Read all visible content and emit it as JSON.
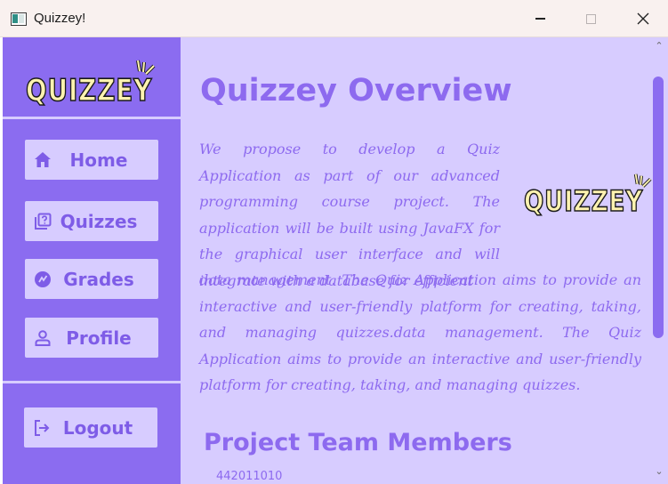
{
  "window": {
    "title": "Quizzey!",
    "icon": "app-window-icon",
    "controls": [
      "minimize",
      "maximize",
      "close"
    ]
  },
  "sidebar": {
    "logo_text": "QUIZZEY",
    "items": [
      {
        "label": "Home",
        "icon": "home-icon"
      },
      {
        "label": "Quizzes",
        "icon": "quiz-icon"
      },
      {
        "label": "Grades",
        "icon": "grades-icon"
      },
      {
        "label": "Profile",
        "icon": "person-icon"
      }
    ],
    "logout": {
      "label": "Logout",
      "icon": "logout-icon"
    }
  },
  "main": {
    "title": "Quizzey Overview",
    "paragraph_part1": "We propose to develop a Quiz Application as part of our advanced programming course project. The application will be built using JavaFX for the graphical user interface and will integrate with a database for efficient",
    "paragraph_part2": "data management. The Quiz Application aims to provide an interactive and user-friendly platform for creating, taking, and managing quizzes.data management. The Quiz Application aims to provide an interactive and user-friendly platform for creating, taking, and managing quizzes.",
    "logo_text": "QUIZZEY",
    "team_title": "Project Team Members",
    "team_first_row_peek": "442011010"
  },
  "colors": {
    "sidebar_bg": "#8b6cf0",
    "content_bg": "#d7ccff",
    "accent_text": "#8d6aef",
    "button_bg": "#d7ccff",
    "logo_fill": "#fff3b0"
  }
}
